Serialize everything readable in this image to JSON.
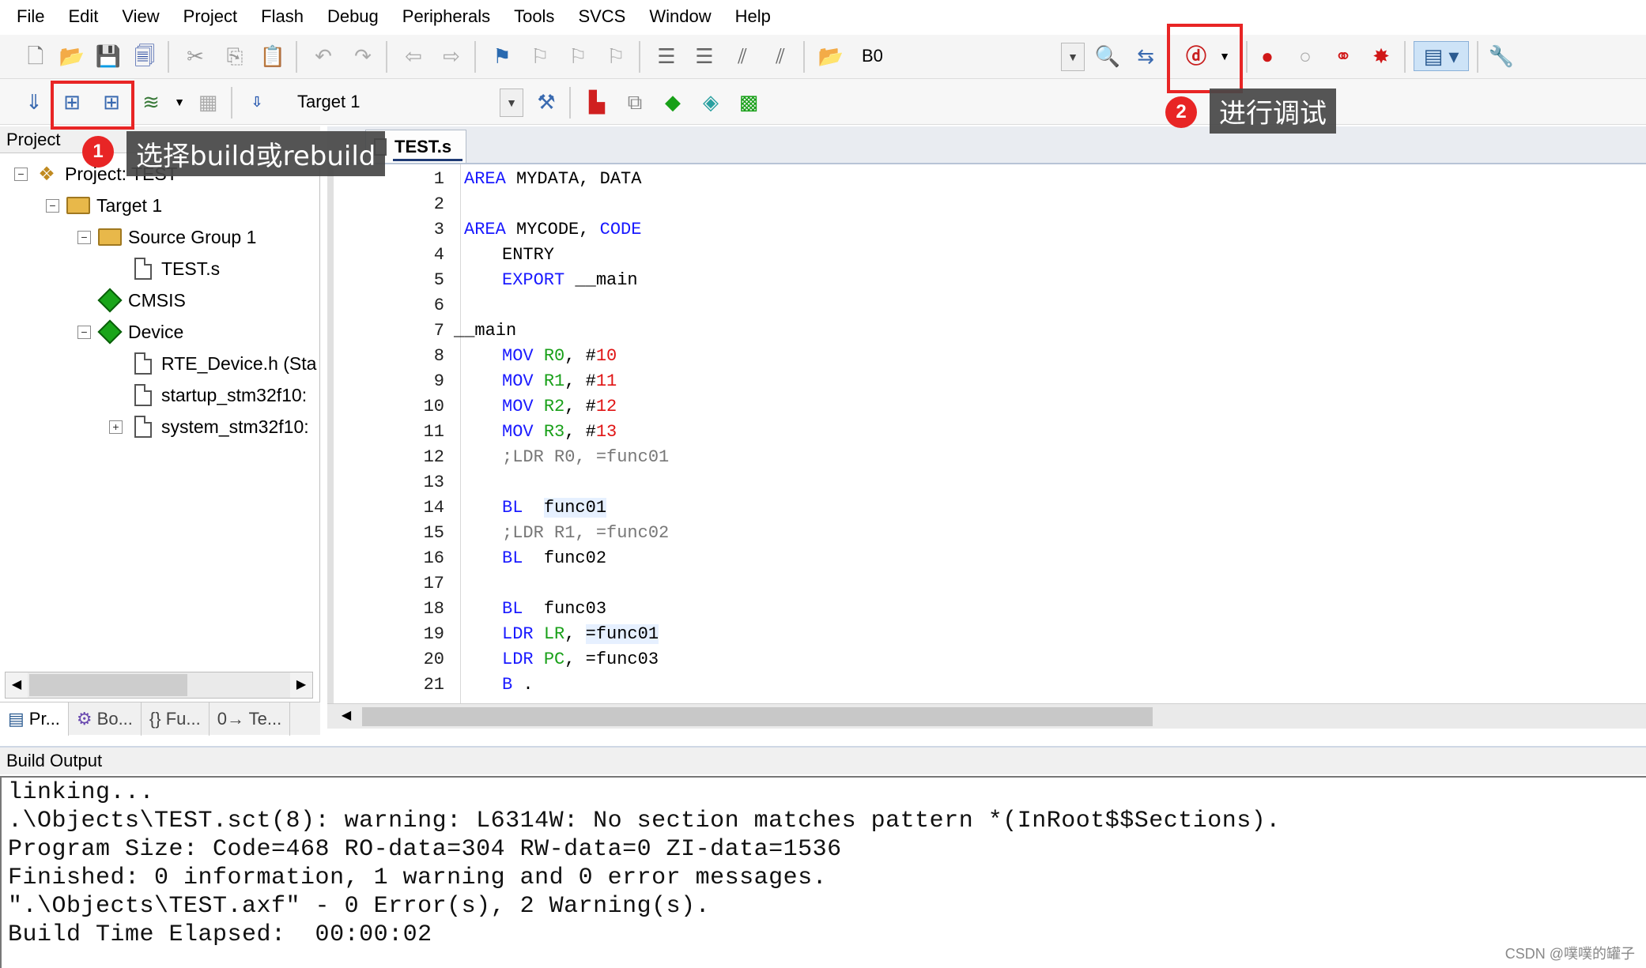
{
  "menu": [
    "File",
    "Edit",
    "View",
    "Project",
    "Flash",
    "Debug",
    "Peripherals",
    "Tools",
    "SVCS",
    "Window",
    "Help"
  ],
  "toolbar": {
    "find_combo_value": "B0",
    "target_combo_value": "Target 1"
  },
  "project_panel": {
    "title": "Project",
    "tree": {
      "root": "Project: TEST",
      "target": "Target 1",
      "source_group": "Source Group 1",
      "source_file": "TEST.s",
      "cmsis": "CMSIS",
      "device": "Device",
      "device_files": [
        "RTE_Device.h (Sta",
        "startup_stm32f10:",
        "system_stm32f10:"
      ]
    },
    "tabs": [
      "Pr...",
      "Bo...",
      "{} Fu...",
      "0→ Te..."
    ]
  },
  "editor": {
    "tab": "TEST.s",
    "line_numbers": [
      "1",
      "2",
      "3",
      "4",
      "5",
      "6",
      "7",
      "8",
      "9",
      "10",
      "11",
      "12",
      "13",
      "14",
      "15",
      "16",
      "17",
      "18",
      "19",
      "20",
      "21"
    ],
    "code": {
      "l1_kw": "AREA",
      "l1_rest": " MYDATA, DATA",
      "l3_kw": "AREA",
      "l3_rest": " MYCODE, ",
      "l3_kw2": "CODE",
      "l4": "ENTRY",
      "l5_kw": "EXPORT",
      "l5_rest": " __main",
      "l7": "__main",
      "mov": "MOV",
      "l8_reg": "R0",
      "l8_num": "10",
      "l9_reg": "R1",
      "l9_num": "11",
      "l10_reg": "R2",
      "l10_num": "12",
      "l11_reg": "R3",
      "l11_num": "13",
      "l12": ";LDR R0, =func01",
      "bl": "BL",
      "l14_target": "func01",
      "l15": ";LDR R1, =func02",
      "l16_target": "func02",
      "l18_target": "func03",
      "ldr": "LDR",
      "l19_reg": "LR",
      "l19_target": "=func01",
      "l20_reg": "PC",
      "l20_target": "=func03",
      "l21_kw": "B",
      "l21_rest": " ."
    }
  },
  "build_output": {
    "title": "Build Output",
    "lines": [
      "linking...",
      ".\\Objects\\TEST.sct(8): warning: L6314W: No section matches pattern *(InRoot$$Sections).",
      "Program Size: Code=468 RO-data=304 RW-data=0 ZI-data=1536",
      "Finished: 0 information, 1 warning and 0 error messages.",
      "\".\\Objects\\TEST.axf\" - 0 Error(s), 2 Warning(s).",
      "Build Time Elapsed:  00:00:02"
    ]
  },
  "annotations": {
    "badge1": "1",
    "tip1": "选择build或rebuild",
    "badge2": "2",
    "tip2": "进行调试",
    "color": "#e82525"
  },
  "watermark": "CSDN @噗噗的罐子",
  "colors": {
    "keyword": "#1a1aff",
    "register": "#19a019",
    "number": "#e01414",
    "comment": "#777777"
  }
}
